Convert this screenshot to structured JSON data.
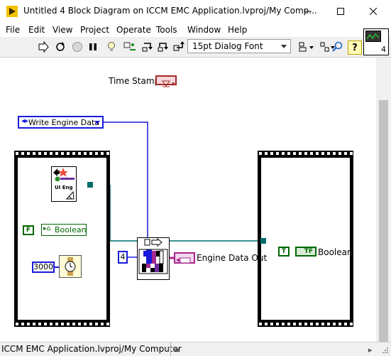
{
  "window": {
    "title": "Untitled 4 Block Diagram on ICCM EMC Application.lvproj/My Comp..."
  },
  "menu": {
    "items": [
      "File",
      "Edit",
      "View",
      "Project",
      "Operate",
      "Tools",
      "Window",
      "Help"
    ]
  },
  "toolbar": {
    "font_select_value": "15pt Dialog Font",
    "help_label": "?",
    "vi_icon_number": "4"
  },
  "diagram": {
    "time_stamp_label": "Time Stamp",
    "enum_constant_value": "Write Engine Data",
    "boolean_false_label": "F",
    "boolean_local_label": "Boolean",
    "wait_ms_value": "3000",
    "numeric_constant_value": "4",
    "engine_data_out_label": "Engine Data Out",
    "boolean_true_label": "T",
    "boolean_indicator_text": "TF",
    "boolean_indicator_label": "Boolean",
    "ui_eng_text": "UI Eng"
  },
  "status": {
    "path": "ICCM EMC Application.lvproj/My Computer"
  },
  "colors": {
    "enum_blue": "#1a1adb",
    "numeric_blue": "#1a1adb",
    "boolean_green": "#006600",
    "cluster_pink": "#a5278f",
    "ref_teal": "#006b6b",
    "timestamp_red": "#a52a2a"
  }
}
